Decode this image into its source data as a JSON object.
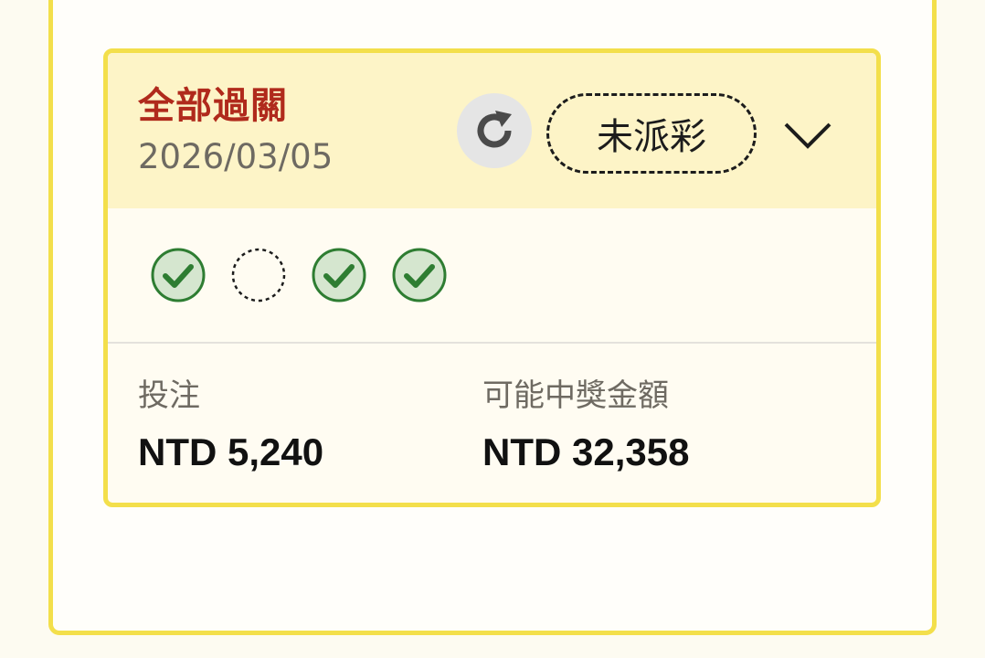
{
  "bet_card": {
    "type_label": "全部過關",
    "date": "2026/03/05",
    "status": "未派彩",
    "legs": [
      {
        "status": "won",
        "icon": "check-circle-icon"
      },
      {
        "status": "pending",
        "icon": "dashed-circle-icon"
      },
      {
        "status": "won",
        "icon": "check-circle-icon"
      },
      {
        "status": "won",
        "icon": "check-circle-icon"
      }
    ],
    "stake": {
      "label": "投注",
      "value": "NTD 5,240"
    },
    "payout": {
      "label": "可能中獎金額",
      "value": "NTD 32,358"
    }
  },
  "colors": {
    "accent_border": "#f3df4b",
    "header_bg": "#fdf4c7",
    "title_red": "#b02a1c",
    "won_green": "#2e7d32",
    "won_fill": "#d5e6cf"
  }
}
